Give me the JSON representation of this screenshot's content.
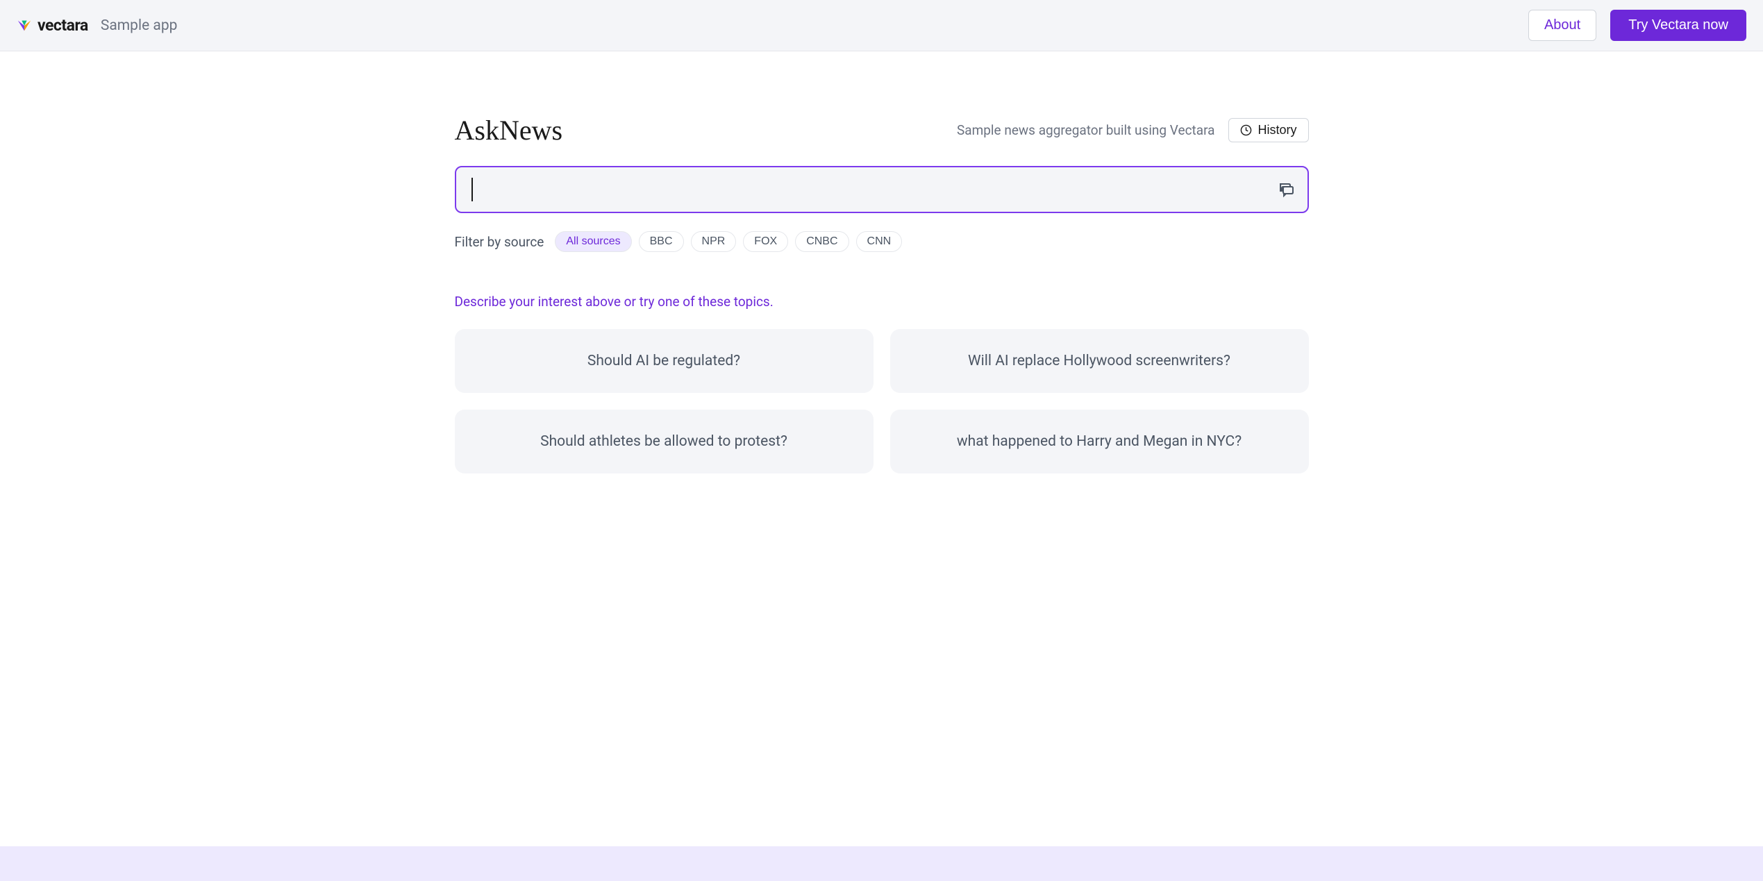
{
  "header": {
    "logo_text": "vectara",
    "sample_app_label": "Sample app",
    "about_label": "About",
    "try_label": "Try Vectara now"
  },
  "main": {
    "title": "AskNews",
    "subtitle": "Sample news aggregator built using Vectara",
    "history_label": "History",
    "search_value": "",
    "filter_label": "Filter by source",
    "filter_pills": [
      {
        "label": "All sources",
        "active": true
      },
      {
        "label": "BBC",
        "active": false
      },
      {
        "label": "NPR",
        "active": false
      },
      {
        "label": "FOX",
        "active": false
      },
      {
        "label": "CNBC",
        "active": false
      },
      {
        "label": "CNN",
        "active": false
      }
    ],
    "describe_text": "Describe your interest above or try one of these topics.",
    "topics": [
      "Should AI be regulated?",
      "Will AI replace Hollywood screenwriters?",
      "Should athletes be allowed to protest?",
      "what happened to Harry and Megan in NYC?"
    ]
  }
}
